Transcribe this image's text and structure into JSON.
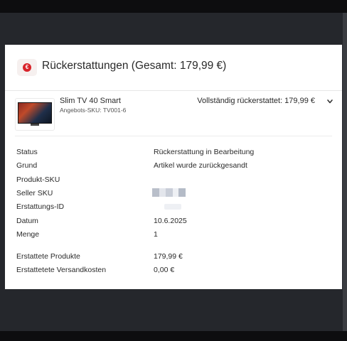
{
  "header": {
    "title": "Rückerstattungen (Gesamt: 179,99 €)",
    "icon": "refund-icon",
    "accent_color": "#d8232a"
  },
  "product": {
    "name": "Slim TV 40 Smart",
    "offer_sku": "Angebots-SKU: TV001-6",
    "refund_status": "Vollständig rückerstattet: 179,99 €",
    "expand_icon": "chevron-down-icon"
  },
  "details": [
    {
      "label": "Status",
      "value": "Rückerstattung in Bearbeitung"
    },
    {
      "label": "Grund",
      "value": "Artikel wurde zurückgesandt"
    },
    {
      "label": "Produkt-SKU",
      "value": ""
    },
    {
      "label": "Seller SKU",
      "value": ""
    },
    {
      "label": "Erstattungs-ID",
      "value": ""
    },
    {
      "label": "Datum",
      "value": "10.6.2025"
    },
    {
      "label": "Menge",
      "value": "1"
    },
    {
      "label": "Erstattete Produkte",
      "value": "179,99 €"
    },
    {
      "label": "Erstattetete Versandkosten",
      "value": "0,00 €"
    }
  ]
}
